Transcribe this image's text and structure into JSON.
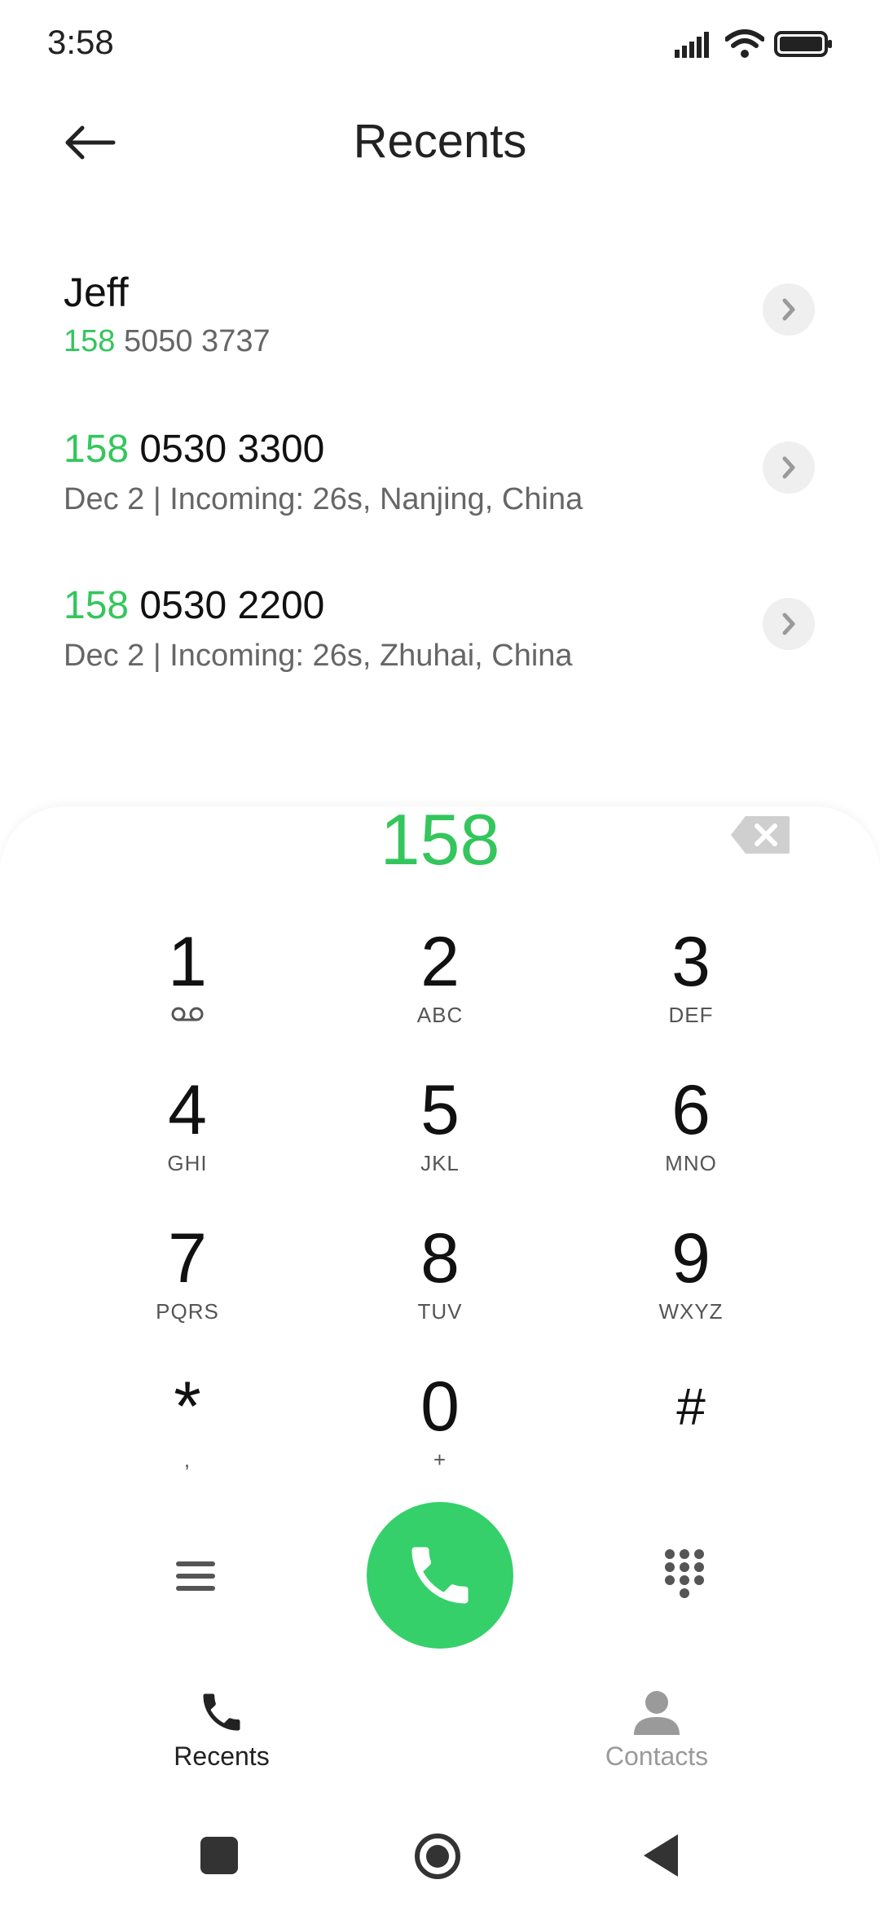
{
  "status_bar": {
    "time": "3:58"
  },
  "header": {
    "title": "Recents"
  },
  "recents": [
    {
      "name": "Jeff",
      "number_prefix": "158",
      "number_rest": " 5050 3737"
    },
    {
      "number_prefix": "158",
      "number_rest": " 0530 3300",
      "detail": "Dec 2 | Incoming: 26s, Nanjing, China"
    },
    {
      "number_prefix": "158",
      "number_rest": " 0530 2200",
      "detail": "Dec 2 | Incoming: 26s, Zhuhai, China"
    }
  ],
  "dialpad": {
    "input": "158",
    "keys": [
      {
        "digit": "1",
        "letters": ""
      },
      {
        "digit": "2",
        "letters": "ABC"
      },
      {
        "digit": "3",
        "letters": "DEF"
      },
      {
        "digit": "4",
        "letters": "GHI"
      },
      {
        "digit": "5",
        "letters": "JKL"
      },
      {
        "digit": "6",
        "letters": "MNO"
      },
      {
        "digit": "7",
        "letters": "PQRS"
      },
      {
        "digit": "8",
        "letters": "TUV"
      },
      {
        "digit": "9",
        "letters": "WXYZ"
      },
      {
        "digit": "*",
        "letters": ","
      },
      {
        "digit": "0",
        "letters": "+"
      },
      {
        "digit": "#",
        "letters": ""
      }
    ]
  },
  "tabs": [
    {
      "label": "Recents",
      "active": true
    },
    {
      "label": "Contacts",
      "active": false
    }
  ],
  "colors": {
    "accent": "#35d06a",
    "text_secondary": "#666666",
    "inactive": "#9a9a9a"
  },
  "icons": {
    "back": "arrow-left-icon",
    "chevron": "chevron-right-icon",
    "backspace": "backspace-icon",
    "voicemail": "voicemail-icon",
    "menu": "menu-icon",
    "call": "phone-icon",
    "keypad": "keypad-icon",
    "contacts": "person-icon"
  }
}
